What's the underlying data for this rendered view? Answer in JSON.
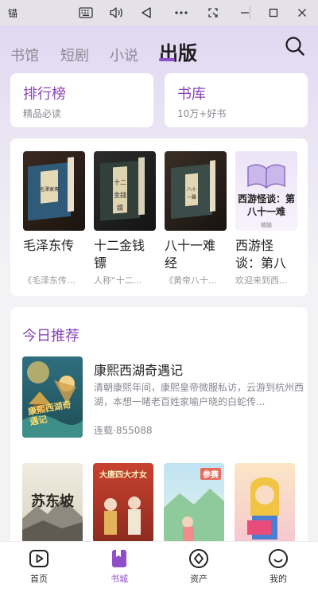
{
  "window": {
    "title": "锚",
    "buttons": [
      "keyboard-icon",
      "volume-icon",
      "back-triangle-icon",
      "more-icon",
      "screenshot-icon",
      "minimize-icon",
      "maximize-icon",
      "close-icon"
    ]
  },
  "tabs": [
    {
      "label": "书馆",
      "active": false
    },
    {
      "label": "短剧",
      "active": false
    },
    {
      "label": "小说",
      "active": false
    },
    {
      "label": "出版",
      "active": true
    }
  ],
  "categories": [
    {
      "title": "排行榜",
      "subtitle": "精品必读"
    },
    {
      "title": "书库",
      "subtitle": "10万+好书"
    }
  ],
  "books": [
    {
      "title": "毛泽东传",
      "desc": "《毛泽东传..."
    },
    {
      "title": "十二金钱镖",
      "desc": "人称“十二..."
    },
    {
      "title": "八十一难经",
      "desc": "《黄帝八十..."
    },
    {
      "title": "西游怪谈：第八十...",
      "desc": "欢迎来到西...",
      "cover_text": "西游怪谈：第八十一难",
      "cover_author": "橘猫"
    }
  ],
  "recommend": {
    "section_title": "今日推荐",
    "featured": {
      "title": "康熙西湖奇遇记",
      "desc": "清朝康熙年间，康熙皇帝微服私访，云游到杭州西湖，本想一睹老百姓家喻户晓的白蛇传...",
      "meta": "连载·855088",
      "cover_text": "康熙西湖奇遇记"
    },
    "more_covers": [
      {
        "text": "苏东坡"
      },
      {
        "text": "大唐四大才女"
      },
      {
        "text": "参赛"
      },
      {
        "text": ""
      }
    ]
  },
  "bottom_nav": [
    {
      "label": "首页",
      "icon": "play-icon",
      "active": false
    },
    {
      "label": "书城",
      "icon": "bookmark-icon",
      "active": true
    },
    {
      "label": "资产",
      "icon": "diamond-icon",
      "active": false
    },
    {
      "label": "我的",
      "icon": "smile-icon",
      "active": false
    }
  ],
  "colors": {
    "accent": "#8e4fc9",
    "accent_text": "#8a44b8"
  }
}
